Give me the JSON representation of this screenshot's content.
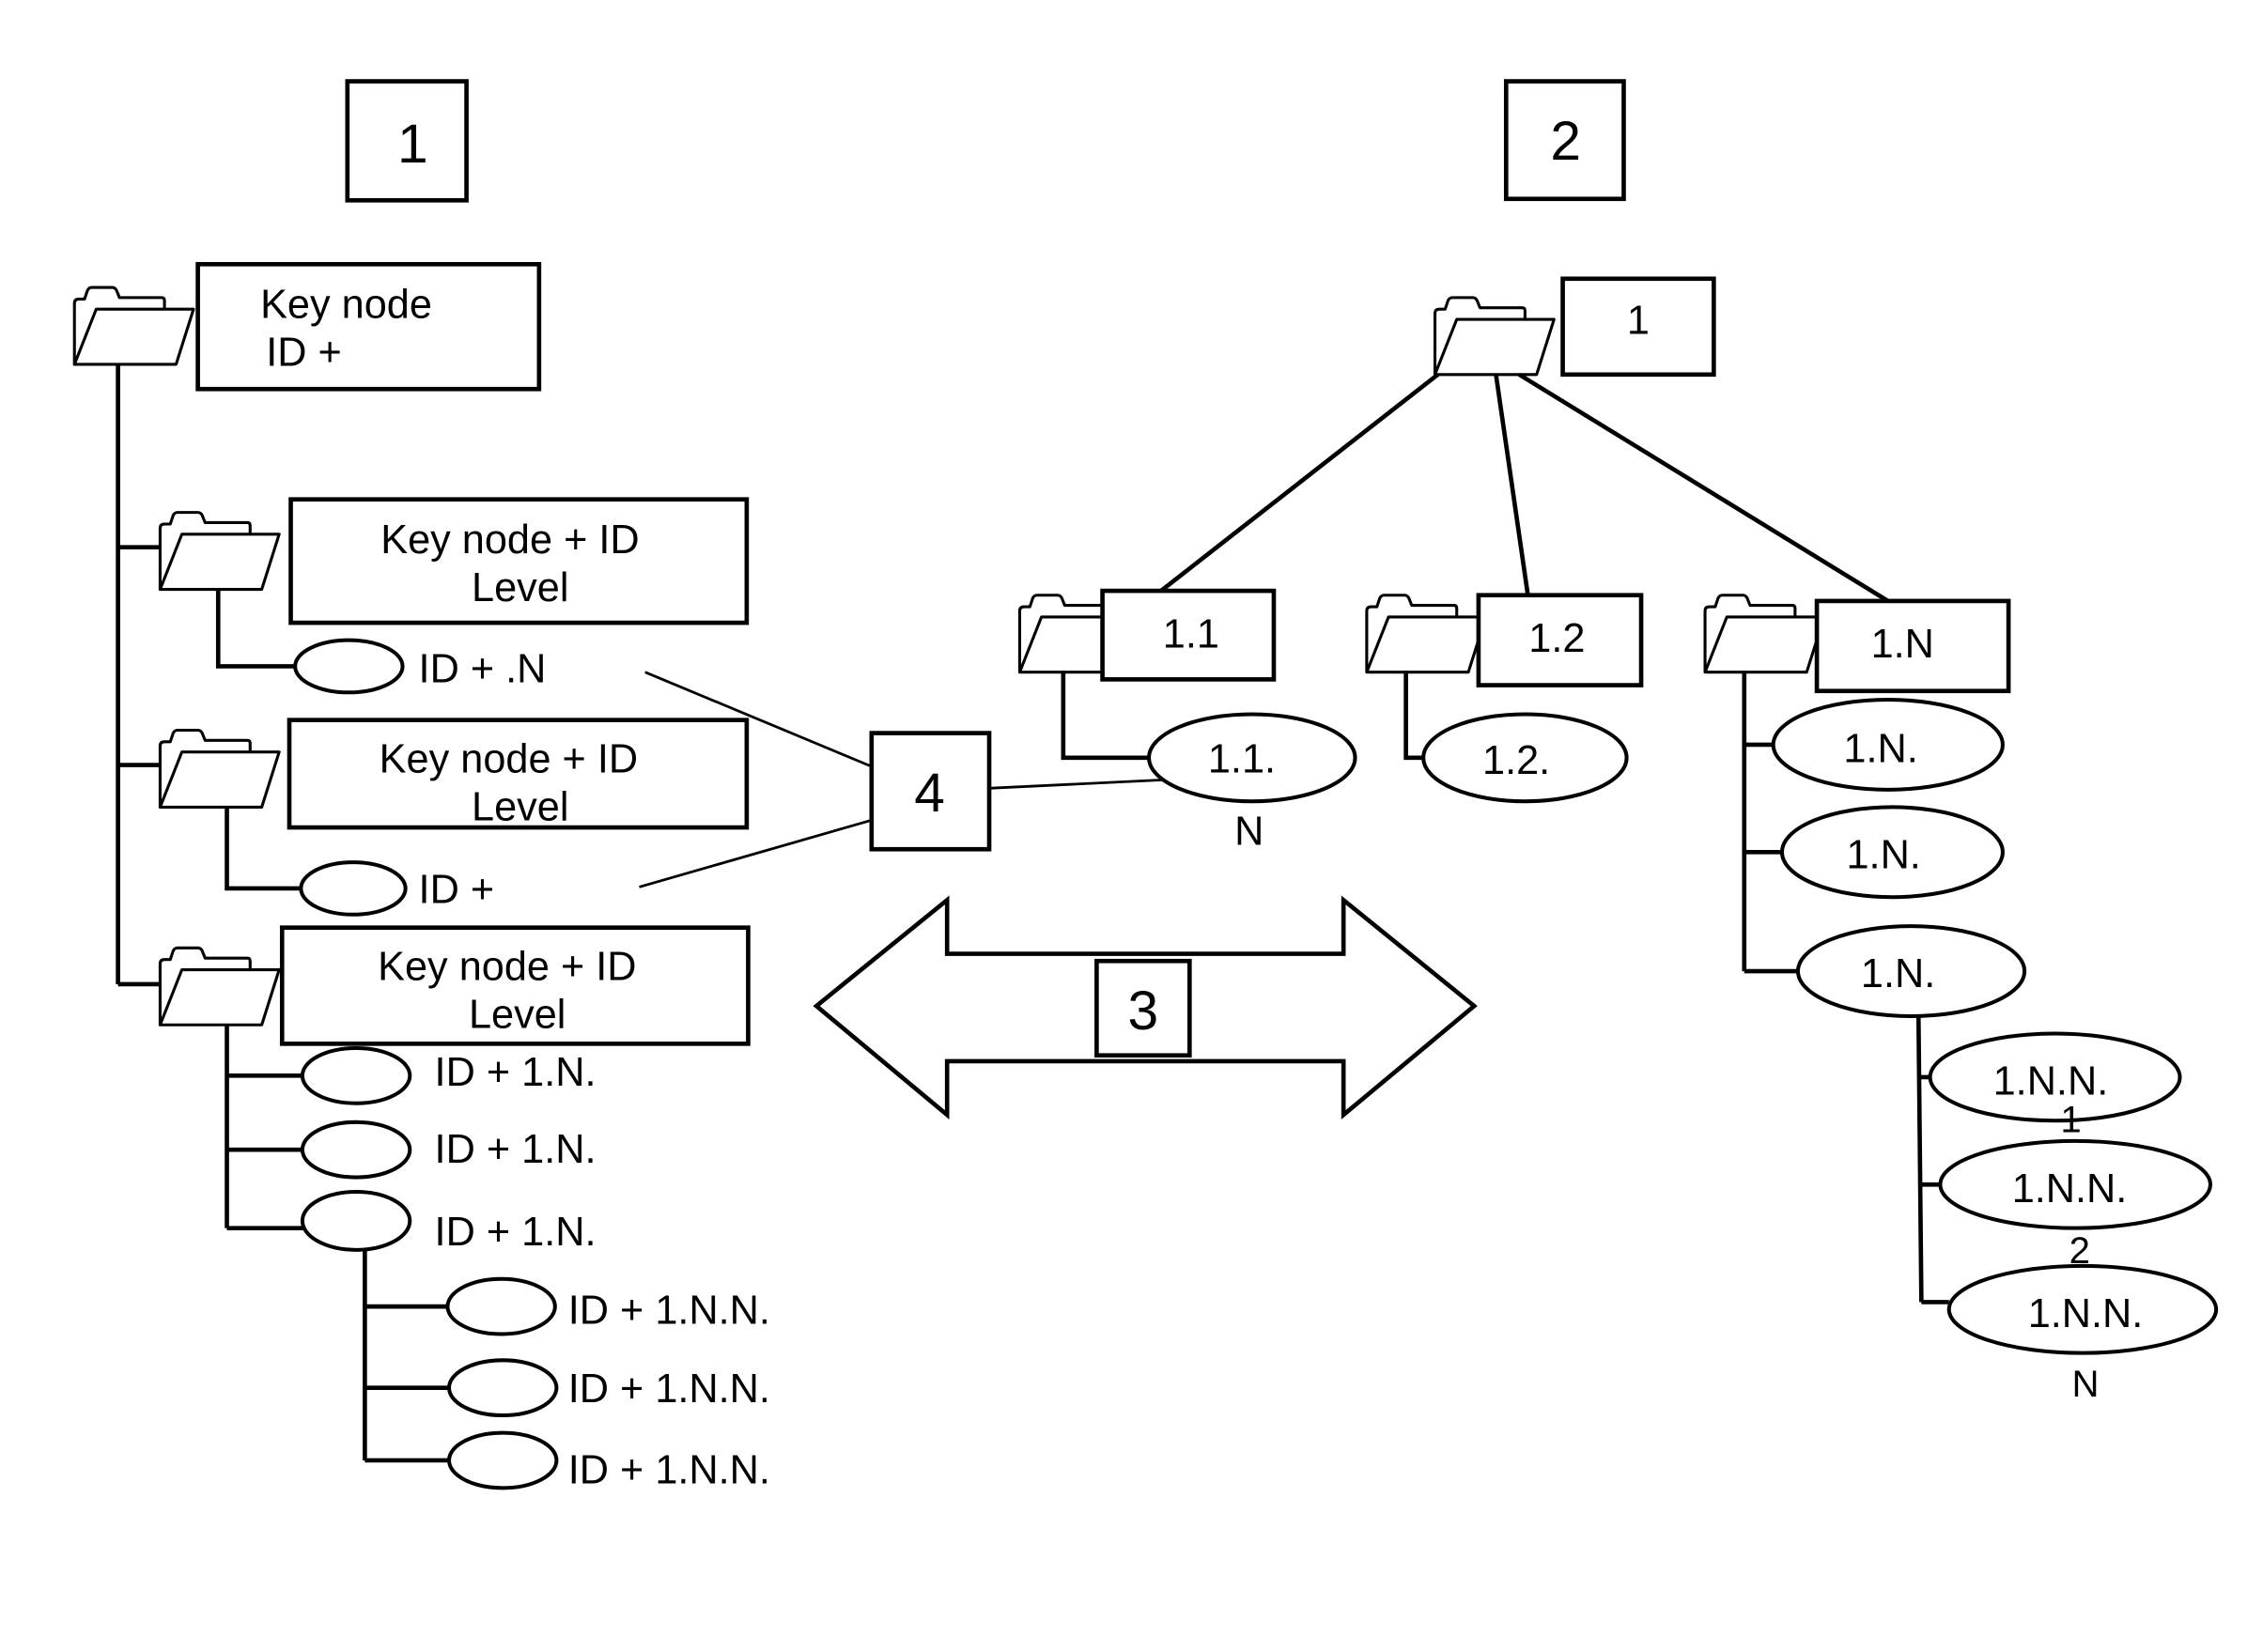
{
  "labels": {
    "panel1": "1",
    "panel2": "2",
    "arrow": "3",
    "link": "4"
  },
  "left_tree": {
    "root": {
      "line1": "Key node",
      "line2": "ID +"
    },
    "branches": [
      {
        "line1": "Key node + ID",
        "line2": "Level",
        "children": [
          "ID +  .N"
        ]
      },
      {
        "line1": "Key node + ID",
        "line2": "Level",
        "children": [
          "ID +"
        ]
      },
      {
        "line1": "Key node + ID",
        "line2": "Level",
        "children": [
          "ID + 1.N.",
          "ID + 1.N.",
          "ID + 1.N."
        ],
        "grandchildren": [
          "ID + 1.N.N.",
          "ID + 1.N.N.",
          "ID + 1.N.N."
        ]
      }
    ]
  },
  "right_tree": {
    "root": "1",
    "folders": [
      {
        "label": "1.1",
        "leaf": "1.1.",
        "leaf_suffix": "N"
      },
      {
        "label": "1.2",
        "leaf": "1.2."
      },
      {
        "label": "1.N",
        "leaves": [
          "1.N.",
          "1.N.",
          "1.N."
        ]
      }
    ],
    "sub_leaves": [
      {
        "label": "1.N.N.",
        "suffix": "1"
      },
      {
        "label": "1.N.N.",
        "suffix": "2"
      },
      {
        "label": "1.N.N.",
        "suffix": "N"
      }
    ]
  }
}
